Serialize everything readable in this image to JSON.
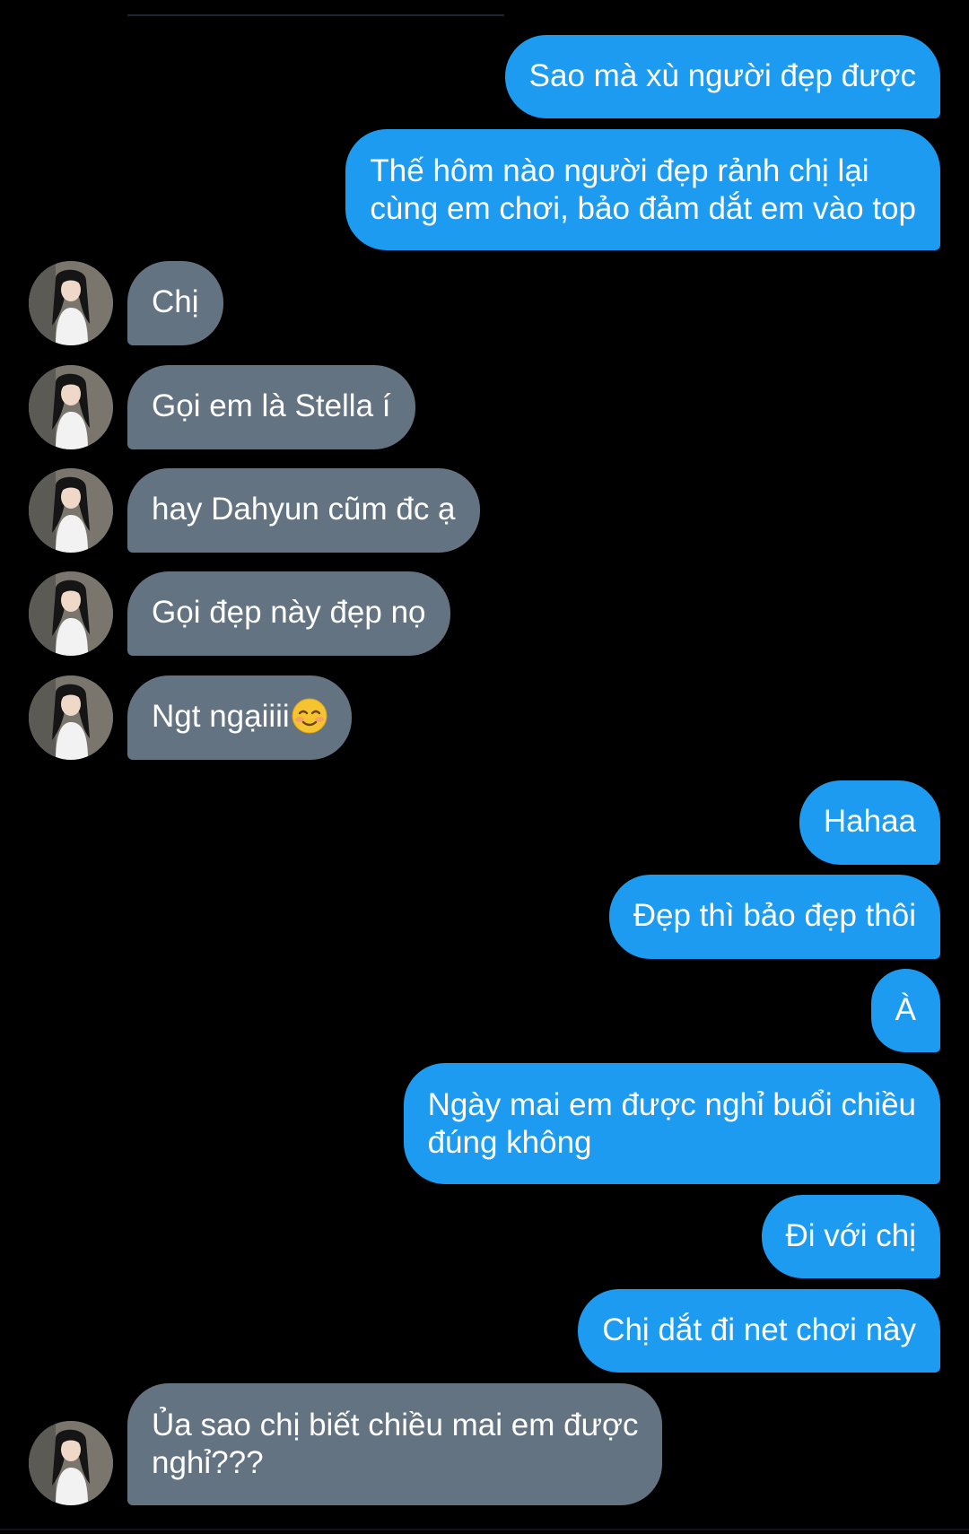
{
  "contact": {
    "avatar_icon": "avatar-photo-icon"
  },
  "colors": {
    "background": "#000000",
    "outgoing_bubble": "#1d9bf0",
    "incoming_bubble": "#637381",
    "text": "#ffffff"
  },
  "messages": [
    {
      "direction": "out",
      "text": "Sao mà xù người đẹp được"
    },
    {
      "direction": "out",
      "lines": [
        "Thế hôm nào người đẹp rảnh chị lại",
        "cùng em chơi, bảo đảm dắt em vào top"
      ]
    },
    {
      "direction": "in",
      "text": "Chị"
    },
    {
      "direction": "in",
      "text": "Gọi em là Stella í"
    },
    {
      "direction": "in",
      "text": "hay Dahyun cũm đc ạ"
    },
    {
      "direction": "in",
      "text": "Gọi đẹp này đẹp nọ"
    },
    {
      "direction": "in",
      "text": "Ngt ngạiiii",
      "emoji": "smiling-face-icon"
    },
    {
      "direction": "out",
      "text": "Hahaa"
    },
    {
      "direction": "out",
      "text": "Đẹp thì bảo đẹp thôi"
    },
    {
      "direction": "out",
      "text": "À"
    },
    {
      "direction": "out",
      "lines": [
        "Ngày mai em được nghỉ buổi chiều",
        "đúng không"
      ]
    },
    {
      "direction": "out",
      "text": "Đi với chị"
    },
    {
      "direction": "out",
      "text": "Chị dắt đi net chơi này"
    },
    {
      "direction": "in",
      "lines": [
        "Ủa sao chị biết chiều mai em được",
        "nghỉ???"
      ]
    }
  ]
}
